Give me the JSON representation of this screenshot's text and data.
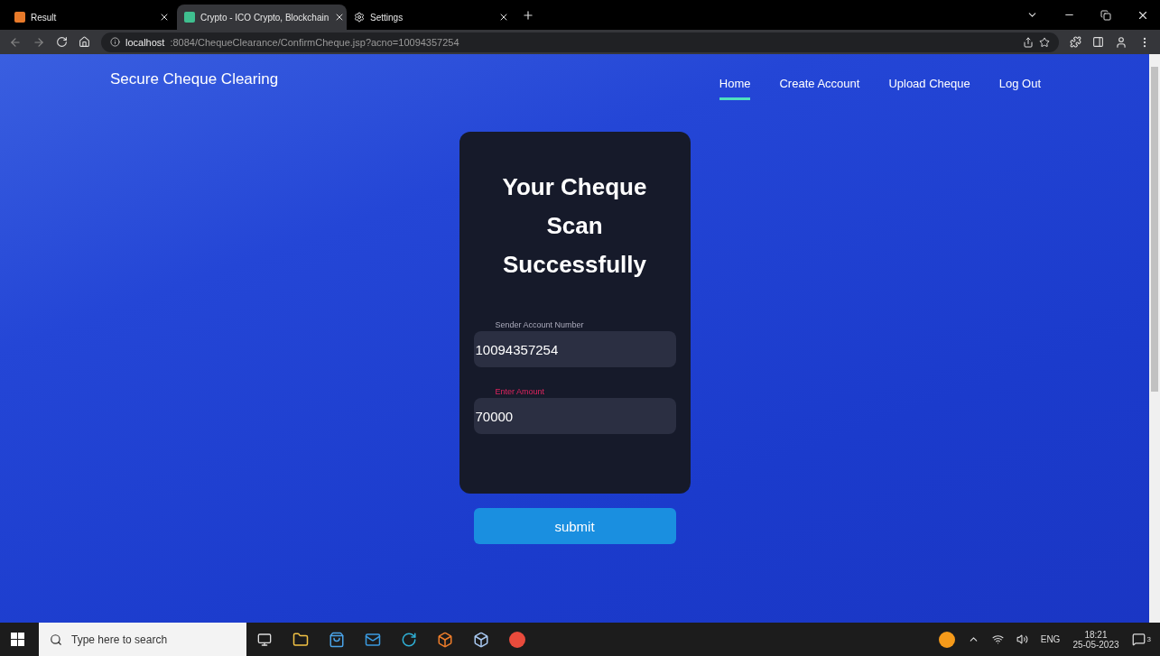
{
  "browser": {
    "tabs": [
      {
        "title": "Result",
        "selected": false
      },
      {
        "title": "Crypto - ICO Crypto, Blockchain",
        "selected": true
      },
      {
        "title": "Settings",
        "selected": false
      }
    ],
    "address": {
      "host": "localhost",
      "path": ":8084/ChequeClearance/ConfirmCheque.jsp?acno=10094357254"
    }
  },
  "site": {
    "brand": "Secure Cheque Clearing",
    "nav": [
      {
        "label": "Home",
        "selected": true
      },
      {
        "label": "Create Account",
        "selected": false
      },
      {
        "label": "Upload Cheque",
        "selected": false
      },
      {
        "label": "Log Out",
        "selected": false
      }
    ]
  },
  "card": {
    "title": "Your Cheque Scan Successfully",
    "fields": [
      {
        "label": "Sender Account Number",
        "value": "10094357254",
        "highlighted": false
      },
      {
        "label": "Enter Amount",
        "value": "70000",
        "highlighted": true
      }
    ]
  },
  "submit": "submit",
  "taskbar": {
    "search_placeholder": "Type here to search",
    "language": "ENG",
    "time": "18:21",
    "date": "25-05-2023",
    "notifications": "3"
  }
}
